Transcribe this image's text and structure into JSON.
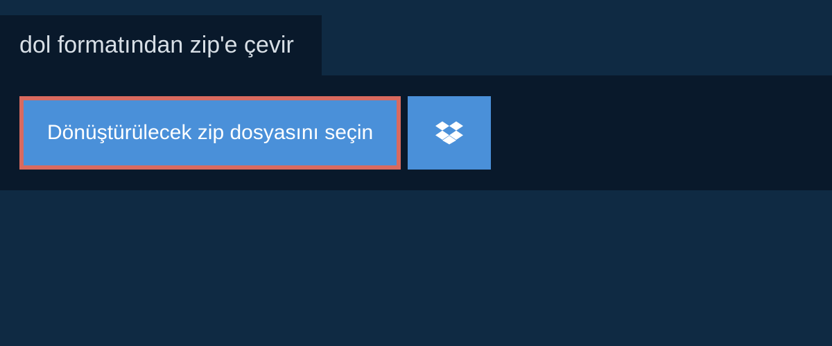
{
  "header": {
    "title": "dol formatından zip'e çevir"
  },
  "actions": {
    "select_file_label": "Dönüştürülecek zip dosyasını seçin"
  },
  "colors": {
    "page_bg": "#0f2a43",
    "panel_bg": "#09192b",
    "button_bg": "#4a90d9",
    "highlight_border": "#d96a5f",
    "text_light": "#d8dfe6"
  }
}
